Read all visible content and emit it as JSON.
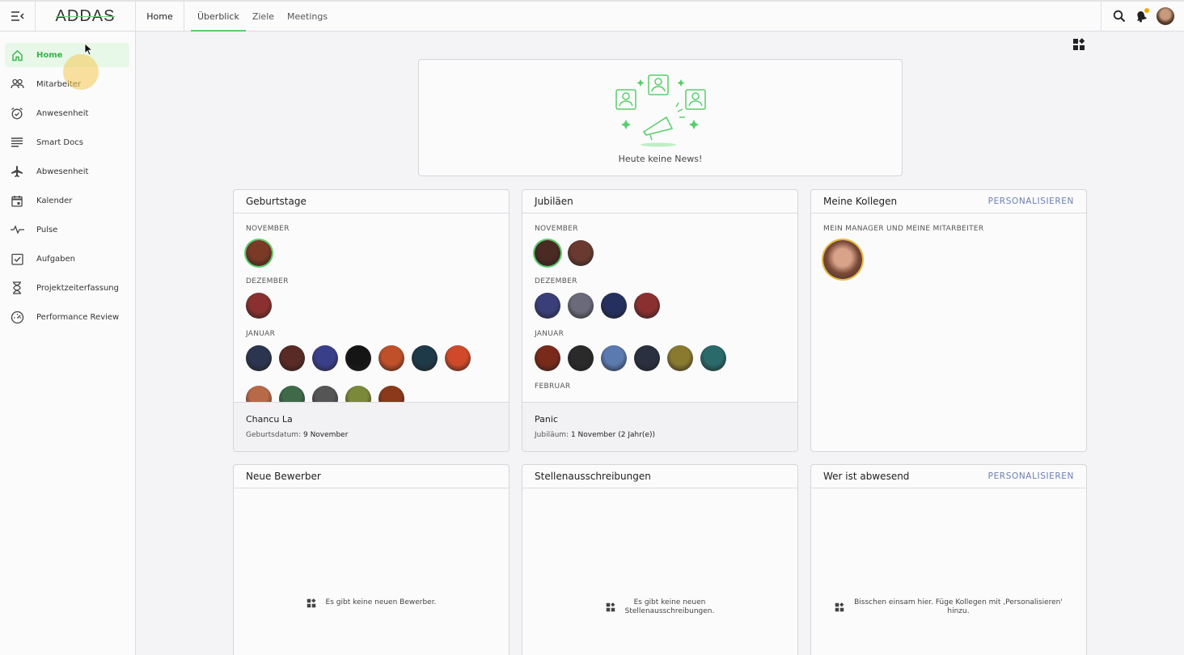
{
  "header": {
    "logo": "ADDAS",
    "home": "Home",
    "tabs": [
      "Überblick",
      "Ziele",
      "Meetings"
    ],
    "active_tab": "Überblick"
  },
  "sidebar": {
    "items": [
      {
        "label": "Home",
        "icon": "home-icon",
        "active": true
      },
      {
        "label": "Mitarbeiter",
        "icon": "people-icon"
      },
      {
        "label": "Anwesenheit",
        "icon": "alarm-clock-icon"
      },
      {
        "label": "Smart Docs",
        "icon": "lines-icon"
      },
      {
        "label": "Abwesenheit",
        "icon": "airplane-icon"
      },
      {
        "label": "Kalender",
        "icon": "calendar-icon"
      },
      {
        "label": "Pulse",
        "icon": "pulse-icon"
      },
      {
        "label": "Aufgaben",
        "icon": "checkbox-icon"
      },
      {
        "label": "Projektzeiterfassung",
        "icon": "hourglass-icon"
      },
      {
        "label": "Performance Review",
        "icon": "gauge-icon"
      }
    ]
  },
  "news": {
    "empty_text": "Heute keine News!"
  },
  "birthdays": {
    "title": "Geburtstage",
    "months": [
      {
        "name": "NOVEMBER",
        "avatars": [
          "#7a3a26"
        ]
      },
      {
        "name": "DEZEMBER",
        "avatars": [
          "#8a3030"
        ]
      },
      {
        "name": "JANUAR",
        "avatars": [
          "#2c3550",
          "#5a2a25",
          "#3a3f8a",
          "#151515",
          "#c0502a",
          "#1e3a48",
          "#d04a2a"
        ]
      },
      {
        "name": "",
        "avatars": [
          "#b86a48",
          "#3e6a4a",
          "#555555",
          "#7a8a3a",
          "#8a3a1a"
        ]
      }
    ],
    "selected_name": "Chancu La",
    "selected_label": "Geburtsdatum:",
    "selected_value": "9 November"
  },
  "jubilees": {
    "title": "Jubiläen",
    "months": [
      {
        "name": "NOVEMBER",
        "avatars": [
          "#4a2a22",
          "#6a3a30"
        ]
      },
      {
        "name": "DEZEMBER",
        "avatars": [
          "#3a3f7a",
          "#6a6a7a",
          "#253060",
          "#8a3030"
        ]
      },
      {
        "name": "JANUAR",
        "avatars": [
          "#7a2a1a",
          "#2a2a2a",
          "#5a7ab0",
          "#2a3040",
          "#8a7a30",
          "#2a6a6a"
        ]
      },
      {
        "name": "FEBRUAR",
        "avatars": []
      }
    ],
    "selected_name": "Panic",
    "selected_label": "Jubiläum:",
    "selected_value": "1 November (2 Jahr(e))"
  },
  "colleagues": {
    "title": "Meine Kollegen",
    "action": "PERSONALISIEREN",
    "section": "MEIN MANAGER UND MEINE MITARBEITER",
    "avatar": "#8a5a4a"
  },
  "applicants": {
    "title": "Neue Bewerber",
    "empty_text": "Es gibt keine neuen Bewerber."
  },
  "jobs": {
    "title": "Stellenausschreibungen",
    "empty_line1": "Es gibt keine neuen",
    "empty_line2": "Stellenausschreibungen."
  },
  "absent": {
    "title": "Wer ist abwesend",
    "action": "PERSONALISIEREN",
    "empty_line1": "Bisschen einsam hier. Füge Kollegen mit ‚Personalisieren'",
    "empty_line2": "hinzu."
  },
  "colors": {
    "accent": "#58cf6a",
    "link": "#6b7fb0",
    "notification": "#f2a900"
  }
}
